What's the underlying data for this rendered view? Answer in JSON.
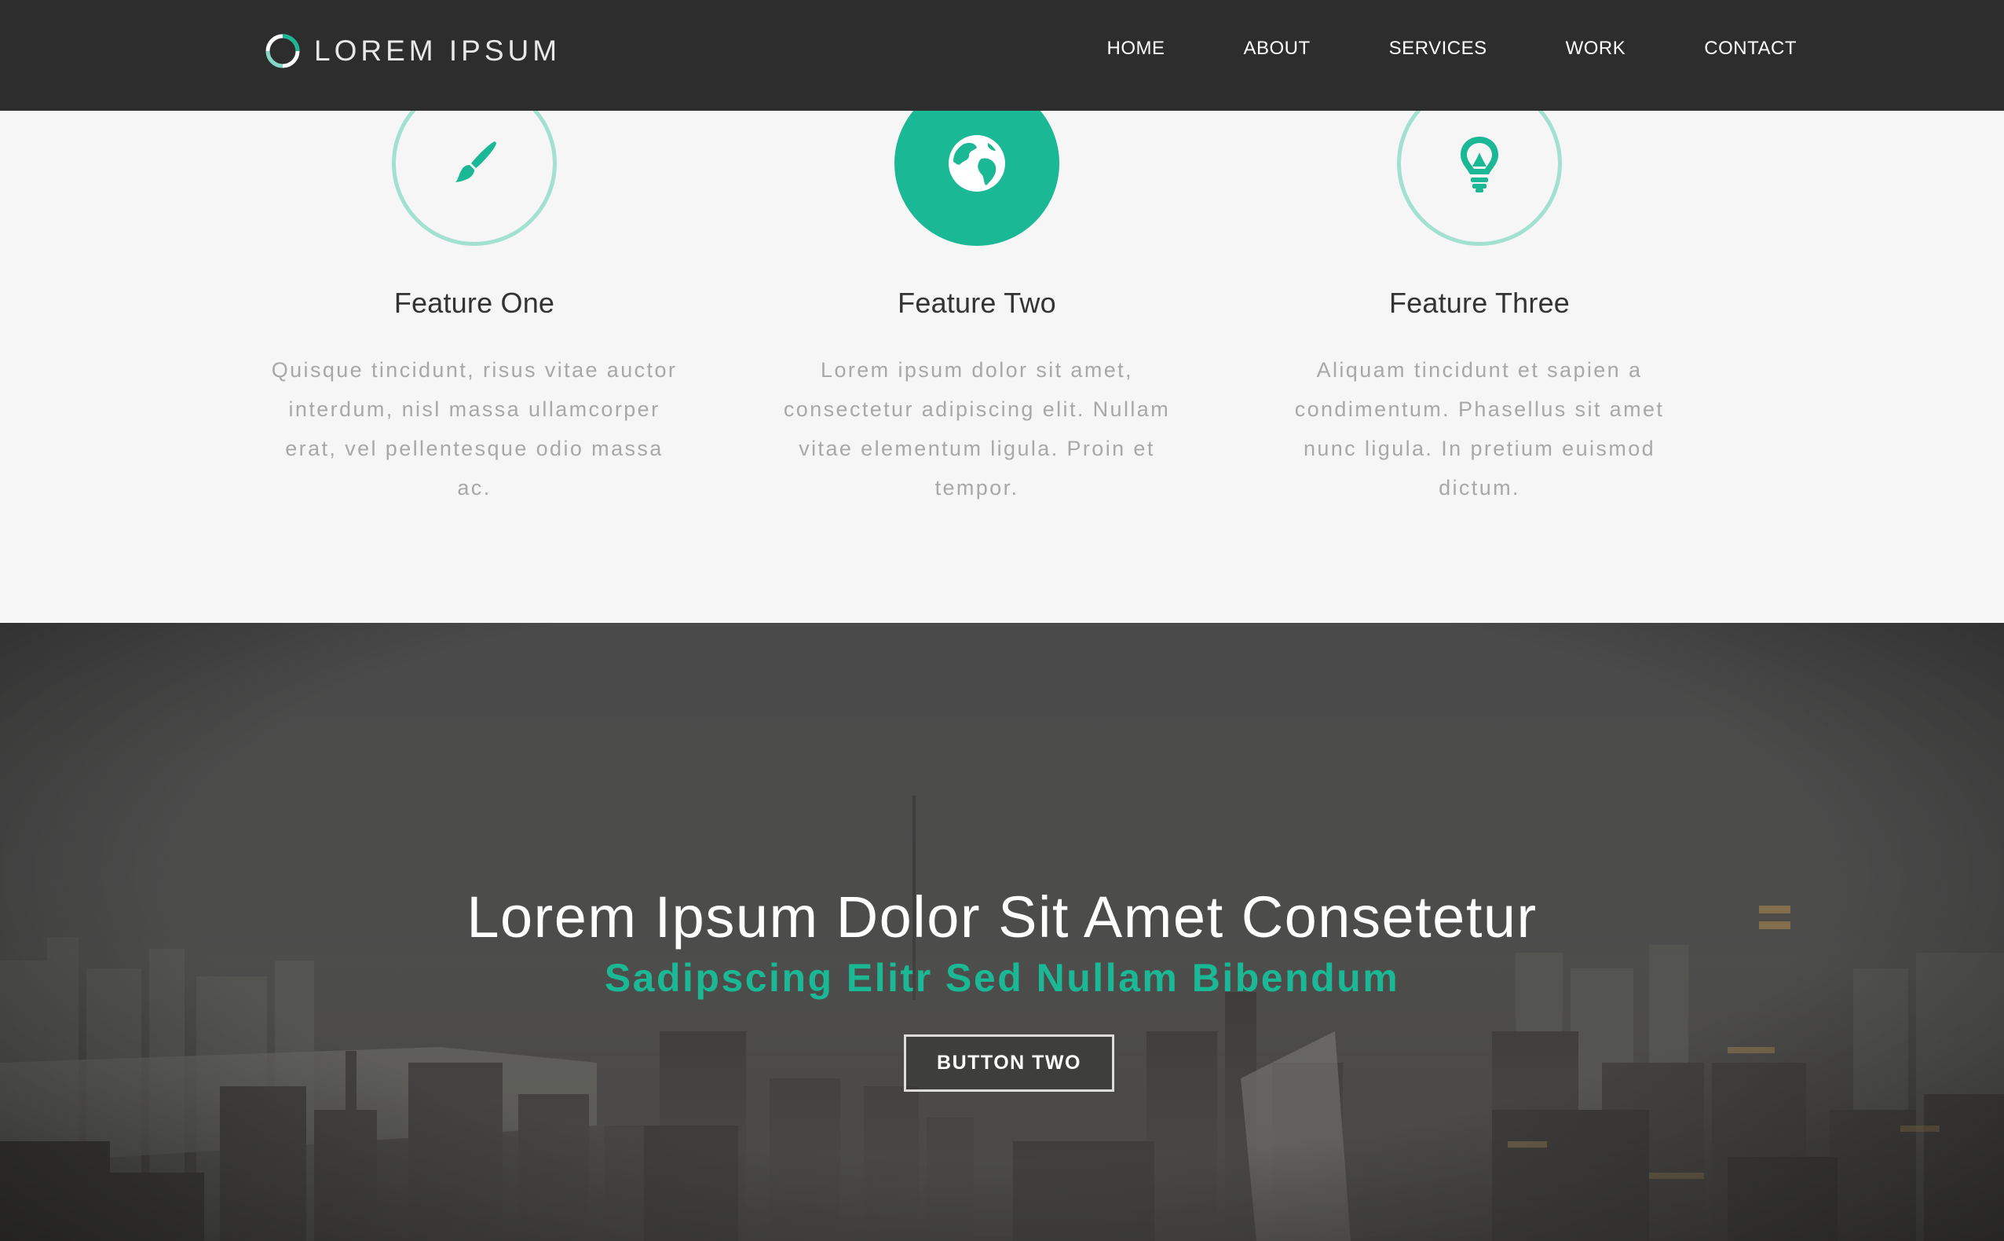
{
  "navbar": {
    "brand": "LOREM IPSUM",
    "items": [
      {
        "label": "HOME"
      },
      {
        "label": "ABOUT"
      },
      {
        "label": "SERVICES"
      },
      {
        "label": "WORK"
      },
      {
        "label": "CONTACT"
      }
    ]
  },
  "features": [
    {
      "icon": "paintbrush-icon",
      "title": "Feature One",
      "text": "Quisque tincidunt, risus vitae auctor interdum, nisl massa ullamcorper erat, vel pellentesque odio massa ac."
    },
    {
      "icon": "globe-icon",
      "title": "Feature Two",
      "text": "Lorem ipsum dolor sit amet, consectetur adipiscing elit. Nullam vitae elementum ligula. Proin et tempor."
    },
    {
      "icon": "lightbulb-icon",
      "title": "Feature Three",
      "text": "Aliquam tincidunt et sapien a condimentum. Phasellus sit amet nunc ligula. In pretium euismod dictum."
    }
  ],
  "hero": {
    "title": "Lorem Ipsum Dolor Sit Amet Consetetur",
    "subtitle": "Sadipscing Elitr Sed Nullam Bibendum",
    "button_label": "BUTTON TWO"
  },
  "colors": {
    "accent": "#1bb895",
    "accent_light": "#a2e0d0",
    "navbar_bg": "#2d2d2d",
    "section_bg": "#f6f6f6"
  }
}
